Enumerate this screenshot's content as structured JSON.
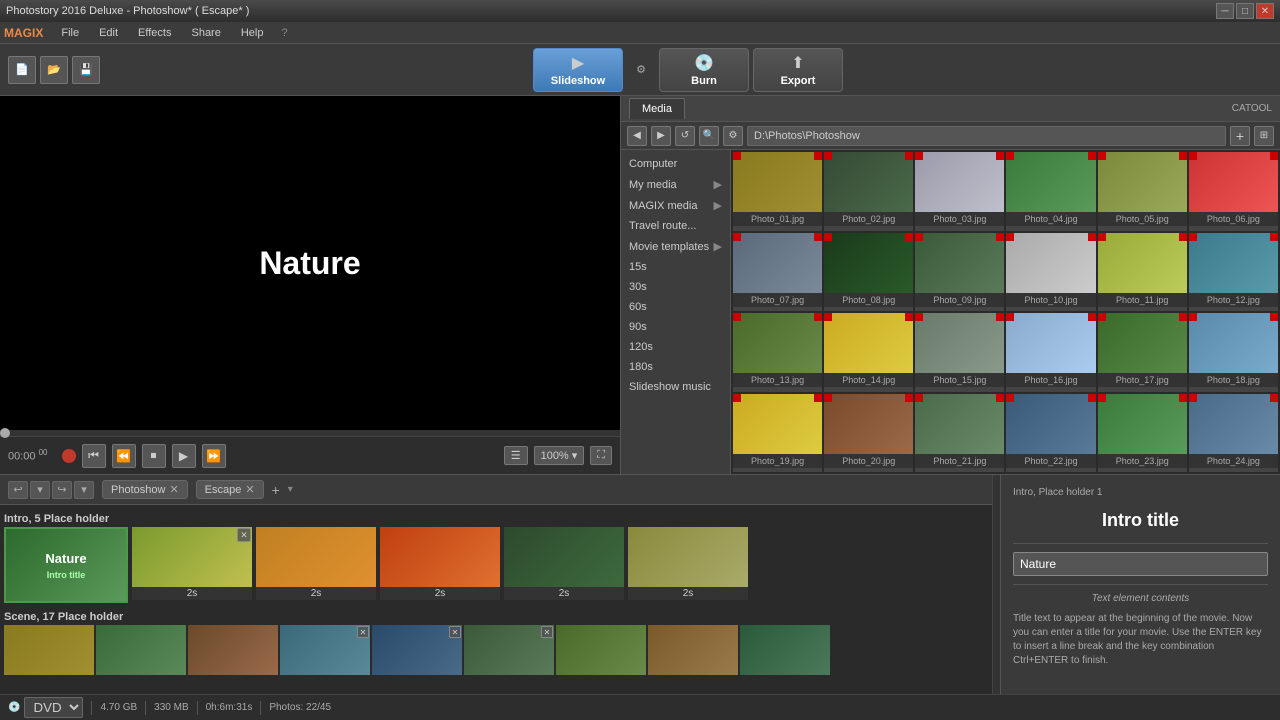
{
  "titlebar": {
    "title": "Photostory 2016 Deluxe - Photoshow* ( Escape* )",
    "minimize": "─",
    "maximize": "□",
    "close": "✕"
  },
  "menubar": {
    "logo": "MAGIX",
    "items": [
      "File",
      "Edit",
      "Effects",
      "Share",
      "Help"
    ]
  },
  "toolbar": {
    "slideshow_label": "Slideshow",
    "burn_label": "Burn",
    "export_label": "Export"
  },
  "media": {
    "tab": "Media",
    "catool": "CATOOL",
    "path": "D:\\Photos\\Photoshow",
    "sidebar_items": [
      {
        "label": "Computer",
        "arrow": false
      },
      {
        "label": "My media",
        "arrow": true
      },
      {
        "label": "MAGIX media",
        "arrow": true
      },
      {
        "label": "Travel route...",
        "arrow": false
      },
      {
        "label": "Movie templates",
        "arrow": true
      },
      {
        "label": "15s"
      },
      {
        "label": "30s"
      },
      {
        "label": "60s"
      },
      {
        "label": "90s"
      },
      {
        "label": "120s"
      },
      {
        "label": "180s"
      },
      {
        "label": "Slideshow music"
      }
    ],
    "photos": [
      "Photo_01.jpg",
      "Photo_02.jpg",
      "Photo_03.jpg",
      "Photo_04.jpg",
      "Photo_05.jpg",
      "Photo_06.jpg",
      "Photo_07.jpg",
      "Photo_08.jpg",
      "Photo_09.jpg",
      "Photo_10.jpg",
      "Photo_11.jpg",
      "Photo_12.jpg",
      "Photo_13.jpg",
      "Photo_14.jpg",
      "Photo_15.jpg",
      "Photo_16.jpg",
      "Photo_17.jpg",
      "Photo_18.jpg",
      "Photo_19.jpg",
      "Photo_20.jpg",
      "Photo_21.jpg",
      "Photo_22.jpg",
      "Photo_23.jpg",
      "Photo_24.jpg"
    ]
  },
  "preview": {
    "title": "Nature",
    "time": "00:00",
    "time_ms": "00"
  },
  "timeline": {
    "tabs": [
      {
        "label": "Photoshow"
      },
      {
        "label": "Escape"
      }
    ],
    "undo": "↩",
    "redo": "↪",
    "intro_label": "Intro, 5 Place holder",
    "scene_label": "Scene, 17 Place holder",
    "clips": [
      {
        "label": "Intro title",
        "color": "clip-thumb-nature",
        "duration": ""
      },
      {
        "label": "",
        "color": "clip-thumb-fields",
        "duration": "2s"
      },
      {
        "label": "",
        "color": "clip-thumb-farm",
        "duration": "2s"
      },
      {
        "label": "",
        "color": "clip-thumb-sunset",
        "duration": "2s"
      },
      {
        "label": "",
        "color": "clip-thumb-forest",
        "duration": "2s"
      },
      {
        "label": "",
        "color": "clip-thumb-dandelion",
        "duration": "2s"
      }
    ]
  },
  "properties": {
    "subtitle": "Intro, Place holder 1",
    "title": "Intro title",
    "input_value": "Nature",
    "section_label": "Text element contents",
    "description": "Title text to appear at the beginning of the movie. Now you can enter a title for your movie. Use the ENTER key to insert a line break and the key combination Ctrl+ENTER to finish."
  },
  "statusbar": {
    "format": "DVD",
    "disk_size": "4.70 GB",
    "memory": "330 MB",
    "duration": "0h:6m:31s",
    "photos": "Photos: 22/45"
  }
}
